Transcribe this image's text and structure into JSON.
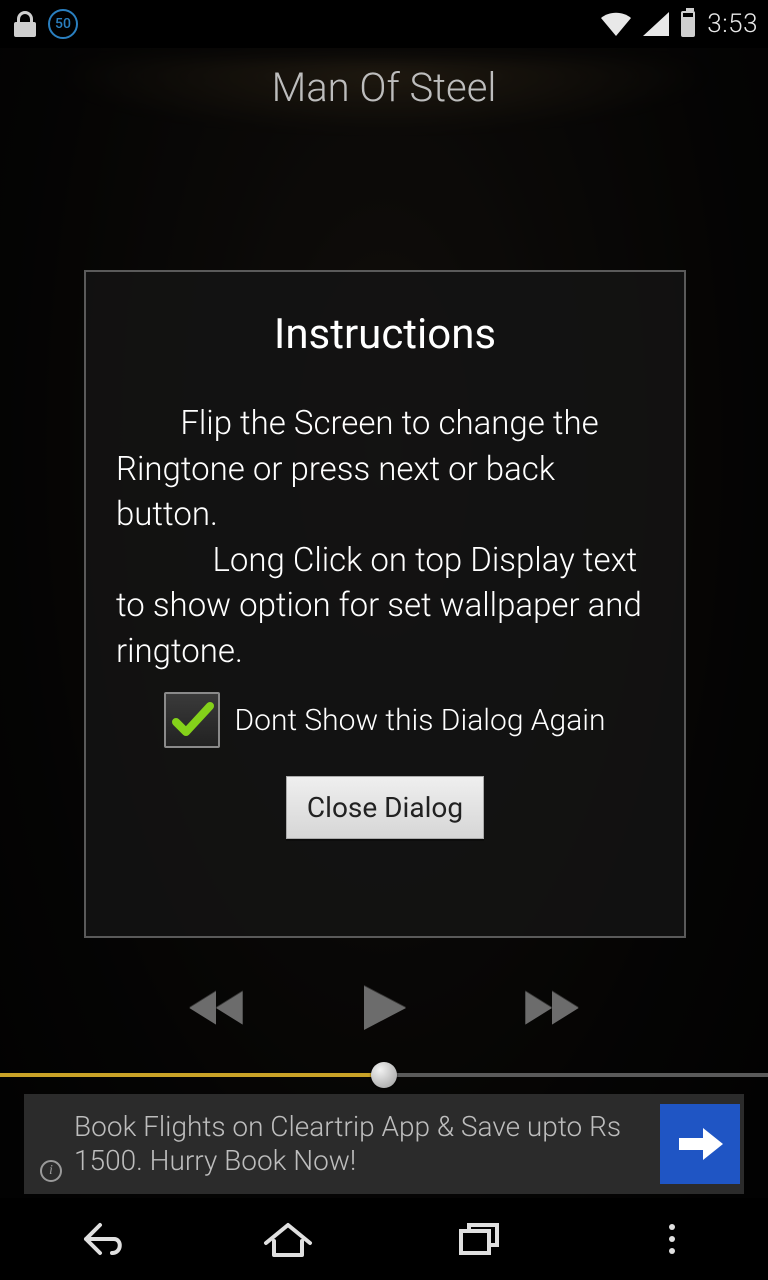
{
  "status": {
    "badge_value": "50",
    "clock": "3:53"
  },
  "header": {
    "title": "Man Of Steel"
  },
  "dialog": {
    "title": "Instructions",
    "body": "        Flip the Screen to change the Ringtone or press next or back button.\n            Long Click on top Display text to show option for set wallpaper and ringtone.",
    "dont_show_label": "Dont Show this Dialog Again",
    "dont_show_checked": true,
    "close_label": "Close Dialog"
  },
  "seek": {
    "progress_percent": 50
  },
  "ad": {
    "text": "Book Flights on Cleartrip App & Save upto Rs 1500. Hurry Book Now!"
  }
}
